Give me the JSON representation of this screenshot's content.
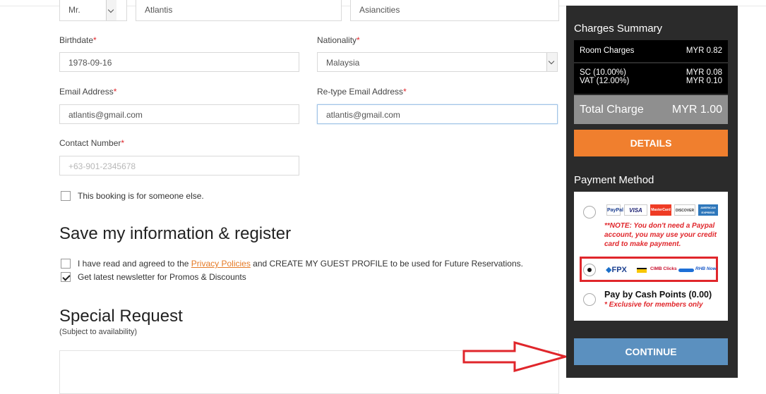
{
  "form": {
    "title_value": "Mr.",
    "first_name_value": "Atlantis",
    "last_name_value": "Asiancities",
    "birthdate": {
      "label": "Birthdate",
      "value": "1978-09-16"
    },
    "nationality": {
      "label": "Nationality",
      "value": "Malaysia"
    },
    "email": {
      "label": "Email Address",
      "value": "atlantis@gmail.com"
    },
    "retype_email": {
      "label": "Re-type Email Address",
      "value": "atlantis@gmail.com"
    },
    "contact": {
      "label": "Contact Number",
      "placeholder": "+63-901-2345678"
    },
    "required_mark": "*",
    "someone_else": "This booking is for someone else."
  },
  "register": {
    "heading": "Save my information & register",
    "agree_prefix": "I have read and agreed to the ",
    "agree_link": "Privacy Policies",
    "agree_suffix": " and CREATE MY GUEST PROFILE to be used for Future Reservations.",
    "agree_checked": false,
    "newsletter": "Get latest newsletter for Promos & Discounts",
    "newsletter_checked": true
  },
  "special": {
    "heading": "Special Request",
    "subtitle": "(Subject to availability)"
  },
  "summary": {
    "title": "Charges Summary",
    "room_label": "Room Charges",
    "room_value": "MYR 0.82",
    "sc_label": "SC (10.00%)",
    "sc_value": "MYR 0.08",
    "vat_label": "VAT (12.00%)",
    "vat_value": "MYR 0.10",
    "total_label": "Total Charge",
    "total_value": "MYR 1.00",
    "details_button": "DETAILS"
  },
  "payment": {
    "title": "Payment Method",
    "cards": [
      "PayPal",
      "VISA",
      "MasterCard",
      "DISCOVER",
      "AMERICAN EXPRESS"
    ],
    "paypal_note": "**NOTE: You don't need a Paypal account, you may use your credit card to make payment.",
    "fpx_logos": [
      "FPX",
      "CIMB Clicks",
      "RHB Now"
    ],
    "cash_label": "Pay by Cash Points (0.00)",
    "cash_note": "* Exclusive for members only",
    "selected": "FPX",
    "continue_button": "CONTINUE"
  },
  "colors": {
    "accent_orange": "#f07f2e",
    "continue_blue": "#5b90bf",
    "sidebar_dark": "#2b2b2b",
    "required_red": "#e0262b"
  }
}
